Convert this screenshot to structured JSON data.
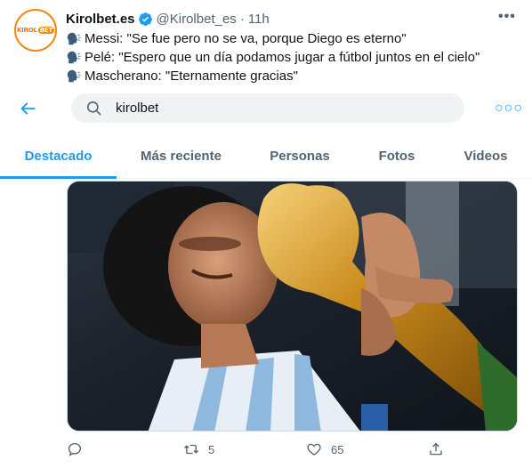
{
  "tweet": {
    "display_name": "Kirolbet.es",
    "handle": "@Kirolbet_es",
    "separator": "·",
    "time": "11h",
    "avatar_logo_text_1": "KIROL",
    "avatar_logo_text_2": "BET",
    "lines": [
      "Messi: \"Se fue pero no se va, porque Diego es eterno\"",
      "Pelé: \"Espero que un día podamos jugar a fútbol juntos en el cielo\"",
      "Mascherano: \"Eternamente gracias\""
    ],
    "more_icon": "more-horizontal-icon",
    "verified_icon": "verified-badge-icon",
    "verified_color": "#1d9bf0"
  },
  "search": {
    "back_icon": "back-arrow-icon",
    "search_icon": "search-icon",
    "value": "kirolbet",
    "more_icon": "more-horizontal-icon",
    "accent": "#1d9bf0"
  },
  "tabs": [
    {
      "label": "Destacado",
      "active": true
    },
    {
      "label": "Más reciente",
      "active": false
    },
    {
      "label": "Personas",
      "active": false
    },
    {
      "label": "Fotos",
      "active": false
    },
    {
      "label": "Videos",
      "active": false
    }
  ],
  "media": {
    "description_icon": "photo-icon"
  },
  "actions": {
    "reply_count": "",
    "retweet_count": "5",
    "like_count": "65",
    "share_count": ""
  }
}
